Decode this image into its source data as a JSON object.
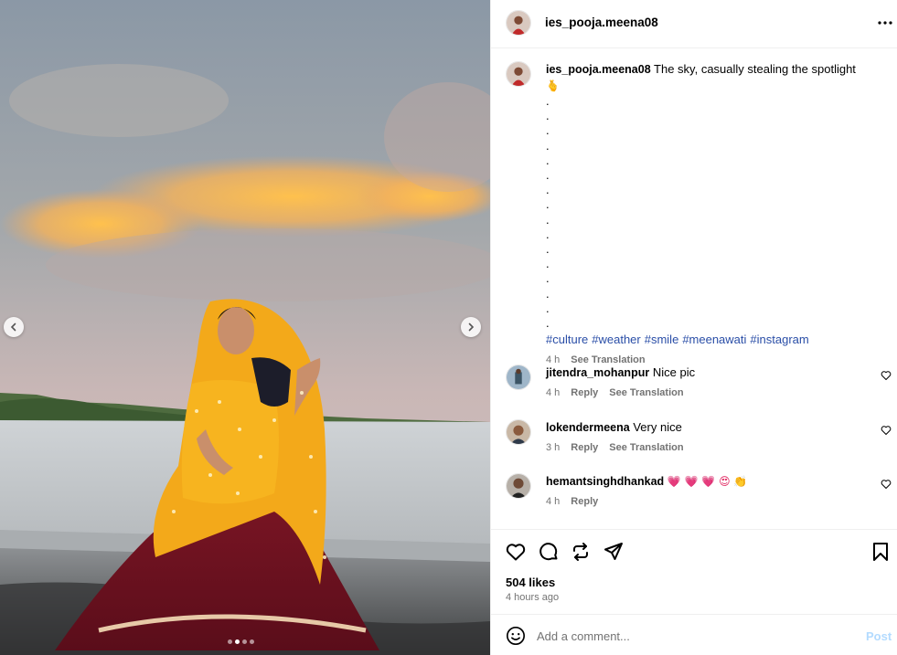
{
  "post": {
    "username": "ies_pooja.meena08",
    "caption": {
      "text": "The sky, casually stealing the spotlight",
      "emoji": "🫰",
      "dots": [
        ".",
        ".",
        ".",
        ".",
        ".",
        ".",
        ".",
        ".",
        ".",
        ".",
        ".",
        ".",
        ".",
        ".",
        ".",
        "."
      ],
      "hashtags": [
        "#culture",
        "#weather",
        "#smile",
        "#meenawati",
        "#instagram"
      ],
      "time": "4 h",
      "see_translation": "See Translation"
    },
    "likes": "504 likes",
    "posted": "4 hours ago",
    "carousel": {
      "count": 4,
      "active": 1
    }
  },
  "comments": [
    {
      "user": "jitendra_mohanpur",
      "text": "Nice pic",
      "time": "4 h",
      "reply": "Reply",
      "see_translation": "See Translation"
    },
    {
      "user": "lokendermeena",
      "text": "Very nice",
      "time": "3 h",
      "reply": "Reply",
      "see_translation": "See Translation"
    },
    {
      "user": "hemantsinghdhankad",
      "text": "💗 💗 💗 😍 👏",
      "time": "4 h",
      "reply": "Reply"
    }
  ],
  "comment_box": {
    "placeholder": "Add a comment...",
    "post_label": "Post"
  },
  "icons": {
    "header": [
      "more-icon"
    ],
    "actions": [
      "heart-icon",
      "comment-icon",
      "repost-icon",
      "share-icon",
      "bookmark-icon"
    ],
    "media": [
      "chevron-left-icon",
      "chevron-right-icon"
    ],
    "composer": [
      "emoji-icon"
    ]
  },
  "colors": {
    "hashtag": "#2a4ea7",
    "post_button_disabled": "#b3dbff",
    "meta_text": "#737373",
    "divider": "#efefef"
  }
}
